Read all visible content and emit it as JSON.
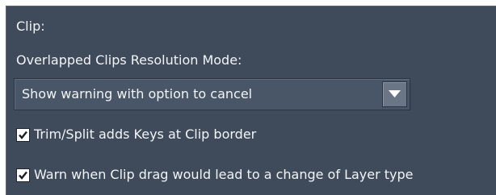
{
  "clip_section": {
    "title": "Clip:",
    "overlap_mode_label": "Overlapped Clips Resolution Mode:",
    "overlap_mode_value": "Show warning with option to cancel",
    "options": [
      {
        "label": "Trim/Split adds Keys at Clip border",
        "checked": true
      },
      {
        "label": "Warn when Clip drag would lead to a change of Layer type",
        "checked": true
      }
    ]
  },
  "icons": {
    "dropdown_arrow": "chevron-down-icon",
    "checkmark": "checkmark-icon"
  },
  "colors": {
    "panel_background": "#3f4b5b",
    "text": "#f2f4f7",
    "control_background": "#495667"
  }
}
